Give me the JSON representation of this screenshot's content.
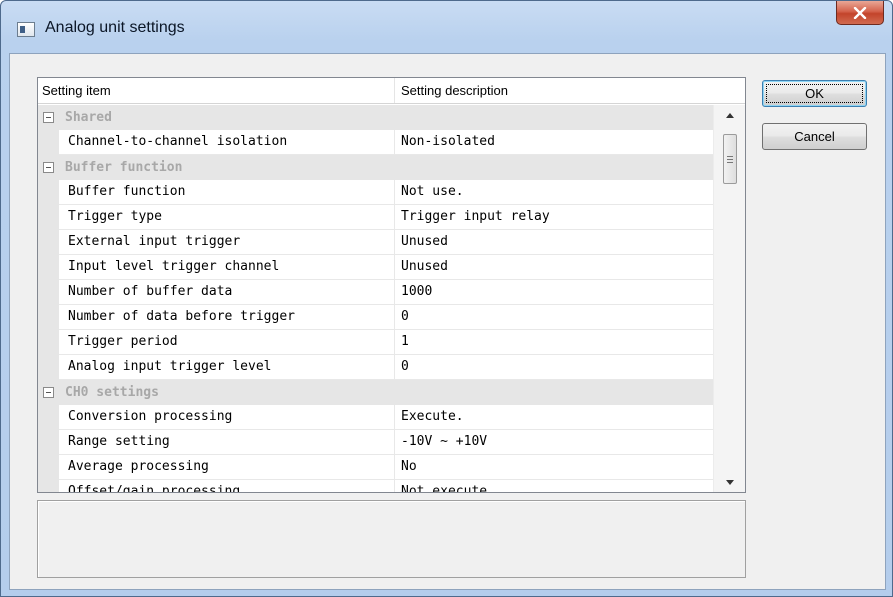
{
  "window": {
    "title": "Analog unit settings",
    "icon": "window-app-icon",
    "close_icon": "close-x-icon"
  },
  "buttons": {
    "ok_label": "OK",
    "cancel_label": "Cancel"
  },
  "grid": {
    "columns": [
      "Setting item",
      "Setting description"
    ],
    "rows": [
      {
        "type": "category",
        "label": "Shared"
      },
      {
        "type": "item",
        "name": "Channel-to-channel isolation",
        "value": "Non-isolated"
      },
      {
        "type": "category",
        "label": "Buffer function"
      },
      {
        "type": "item",
        "name": "Buffer function",
        "value": "Not use."
      },
      {
        "type": "item",
        "name": "Trigger type",
        "value": "Trigger input relay"
      },
      {
        "type": "item",
        "name": "External input trigger",
        "value": "Unused"
      },
      {
        "type": "item",
        "name": "Input level trigger channel",
        "value": "Unused"
      },
      {
        "type": "item",
        "name": "Number of buffer data",
        "value": "1000"
      },
      {
        "type": "item",
        "name": "Number of data before trigger",
        "value": "0"
      },
      {
        "type": "item",
        "name": "Trigger period",
        "value": "1"
      },
      {
        "type": "item",
        "name": "Analog input trigger level",
        "value": "0"
      },
      {
        "type": "category",
        "label": "CH0 settings"
      },
      {
        "type": "item",
        "name": "Conversion processing",
        "value": "Execute."
      },
      {
        "type": "item",
        "name": "Range setting",
        "value": "-10V ~ +10V"
      },
      {
        "type": "item",
        "name": "Average processing",
        "value": "No"
      },
      {
        "type": "item",
        "name": "Offset/gain processing",
        "value": "Not execute."
      }
    ]
  },
  "colors": {
    "title_bar": "#b9d1ee",
    "close_button": "#c3442b",
    "category_text": "#a8a8a8",
    "category_bg": "#e6e6e6"
  }
}
